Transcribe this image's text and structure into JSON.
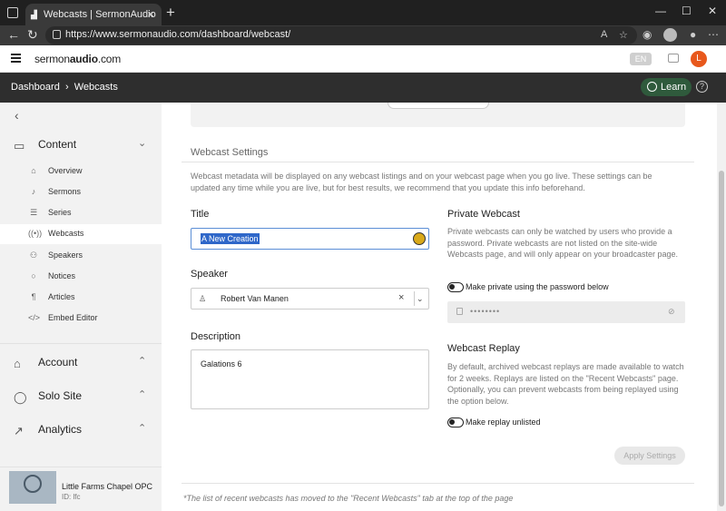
{
  "browser": {
    "tab_title": "Webcasts | SermonAudio",
    "url": "https://www.sermonaudio.com/dashboard/webcast/"
  },
  "header": {
    "logo_light": "sermon",
    "logo_bold": "audio",
    "logo_suffix": ".com",
    "language": "EN",
    "avatar_letter": "L"
  },
  "breadcrumb": {
    "root": "Dashboard",
    "current": "Webcasts"
  },
  "learn_label": "Learn",
  "sidebar": {
    "content": {
      "label": "Content",
      "items": [
        {
          "label": "Overview",
          "icon": "home-icon"
        },
        {
          "label": "Sermons",
          "icon": "mic-icon"
        },
        {
          "label": "Series",
          "icon": "list-icon"
        },
        {
          "label": "Webcasts",
          "icon": "broadcast-icon"
        },
        {
          "label": "Speakers",
          "icon": "people-icon"
        },
        {
          "label": "Notices",
          "icon": "chat-icon"
        },
        {
          "label": "Articles",
          "icon": "paragraph-icon"
        },
        {
          "label": "Embed Editor",
          "icon": "code-icon"
        }
      ]
    },
    "account": "Account",
    "solo_site": "Solo Site",
    "analytics": "Analytics",
    "church": {
      "name": "Little Farms Chapel OPC",
      "id": "ID: lfc"
    }
  },
  "settings": {
    "section_title": "Webcast Settings",
    "intro": "Webcast metadata will be displayed on any webcast listings and on your webcast page when you go live. These settings can be updated any time while you are live, but for best results, we recommend that you update this info beforehand.",
    "title_label": "Title",
    "title_value": "A New Creation",
    "speaker_label": "Speaker",
    "speaker_value": "Robert Van Manen",
    "description_label": "Description",
    "description_value": "Galations 6",
    "private": {
      "title": "Private Webcast",
      "text": "Private webcasts can only be watched by users who provide a password. Private webcasts are not listed on the site-wide Webcasts page, and will only appear on your broadcaster page.",
      "toggle_label": "Make private using the password below",
      "password_mask": "••••••••"
    },
    "replay": {
      "title": "Webcast Replay",
      "text": "By default, archived webcast replays are made available to watch for 2 weeks. Replays are listed on the \"Recent Webcasts\" page. Optionally, you can prevent webcasts from being replayed using the option below.",
      "toggle_label": "Make replay unlisted"
    },
    "apply_label": "Apply Settings",
    "footnote": "*The list of recent webcasts has moved to the \"Recent Webcasts\" tab at the top of the page"
  }
}
